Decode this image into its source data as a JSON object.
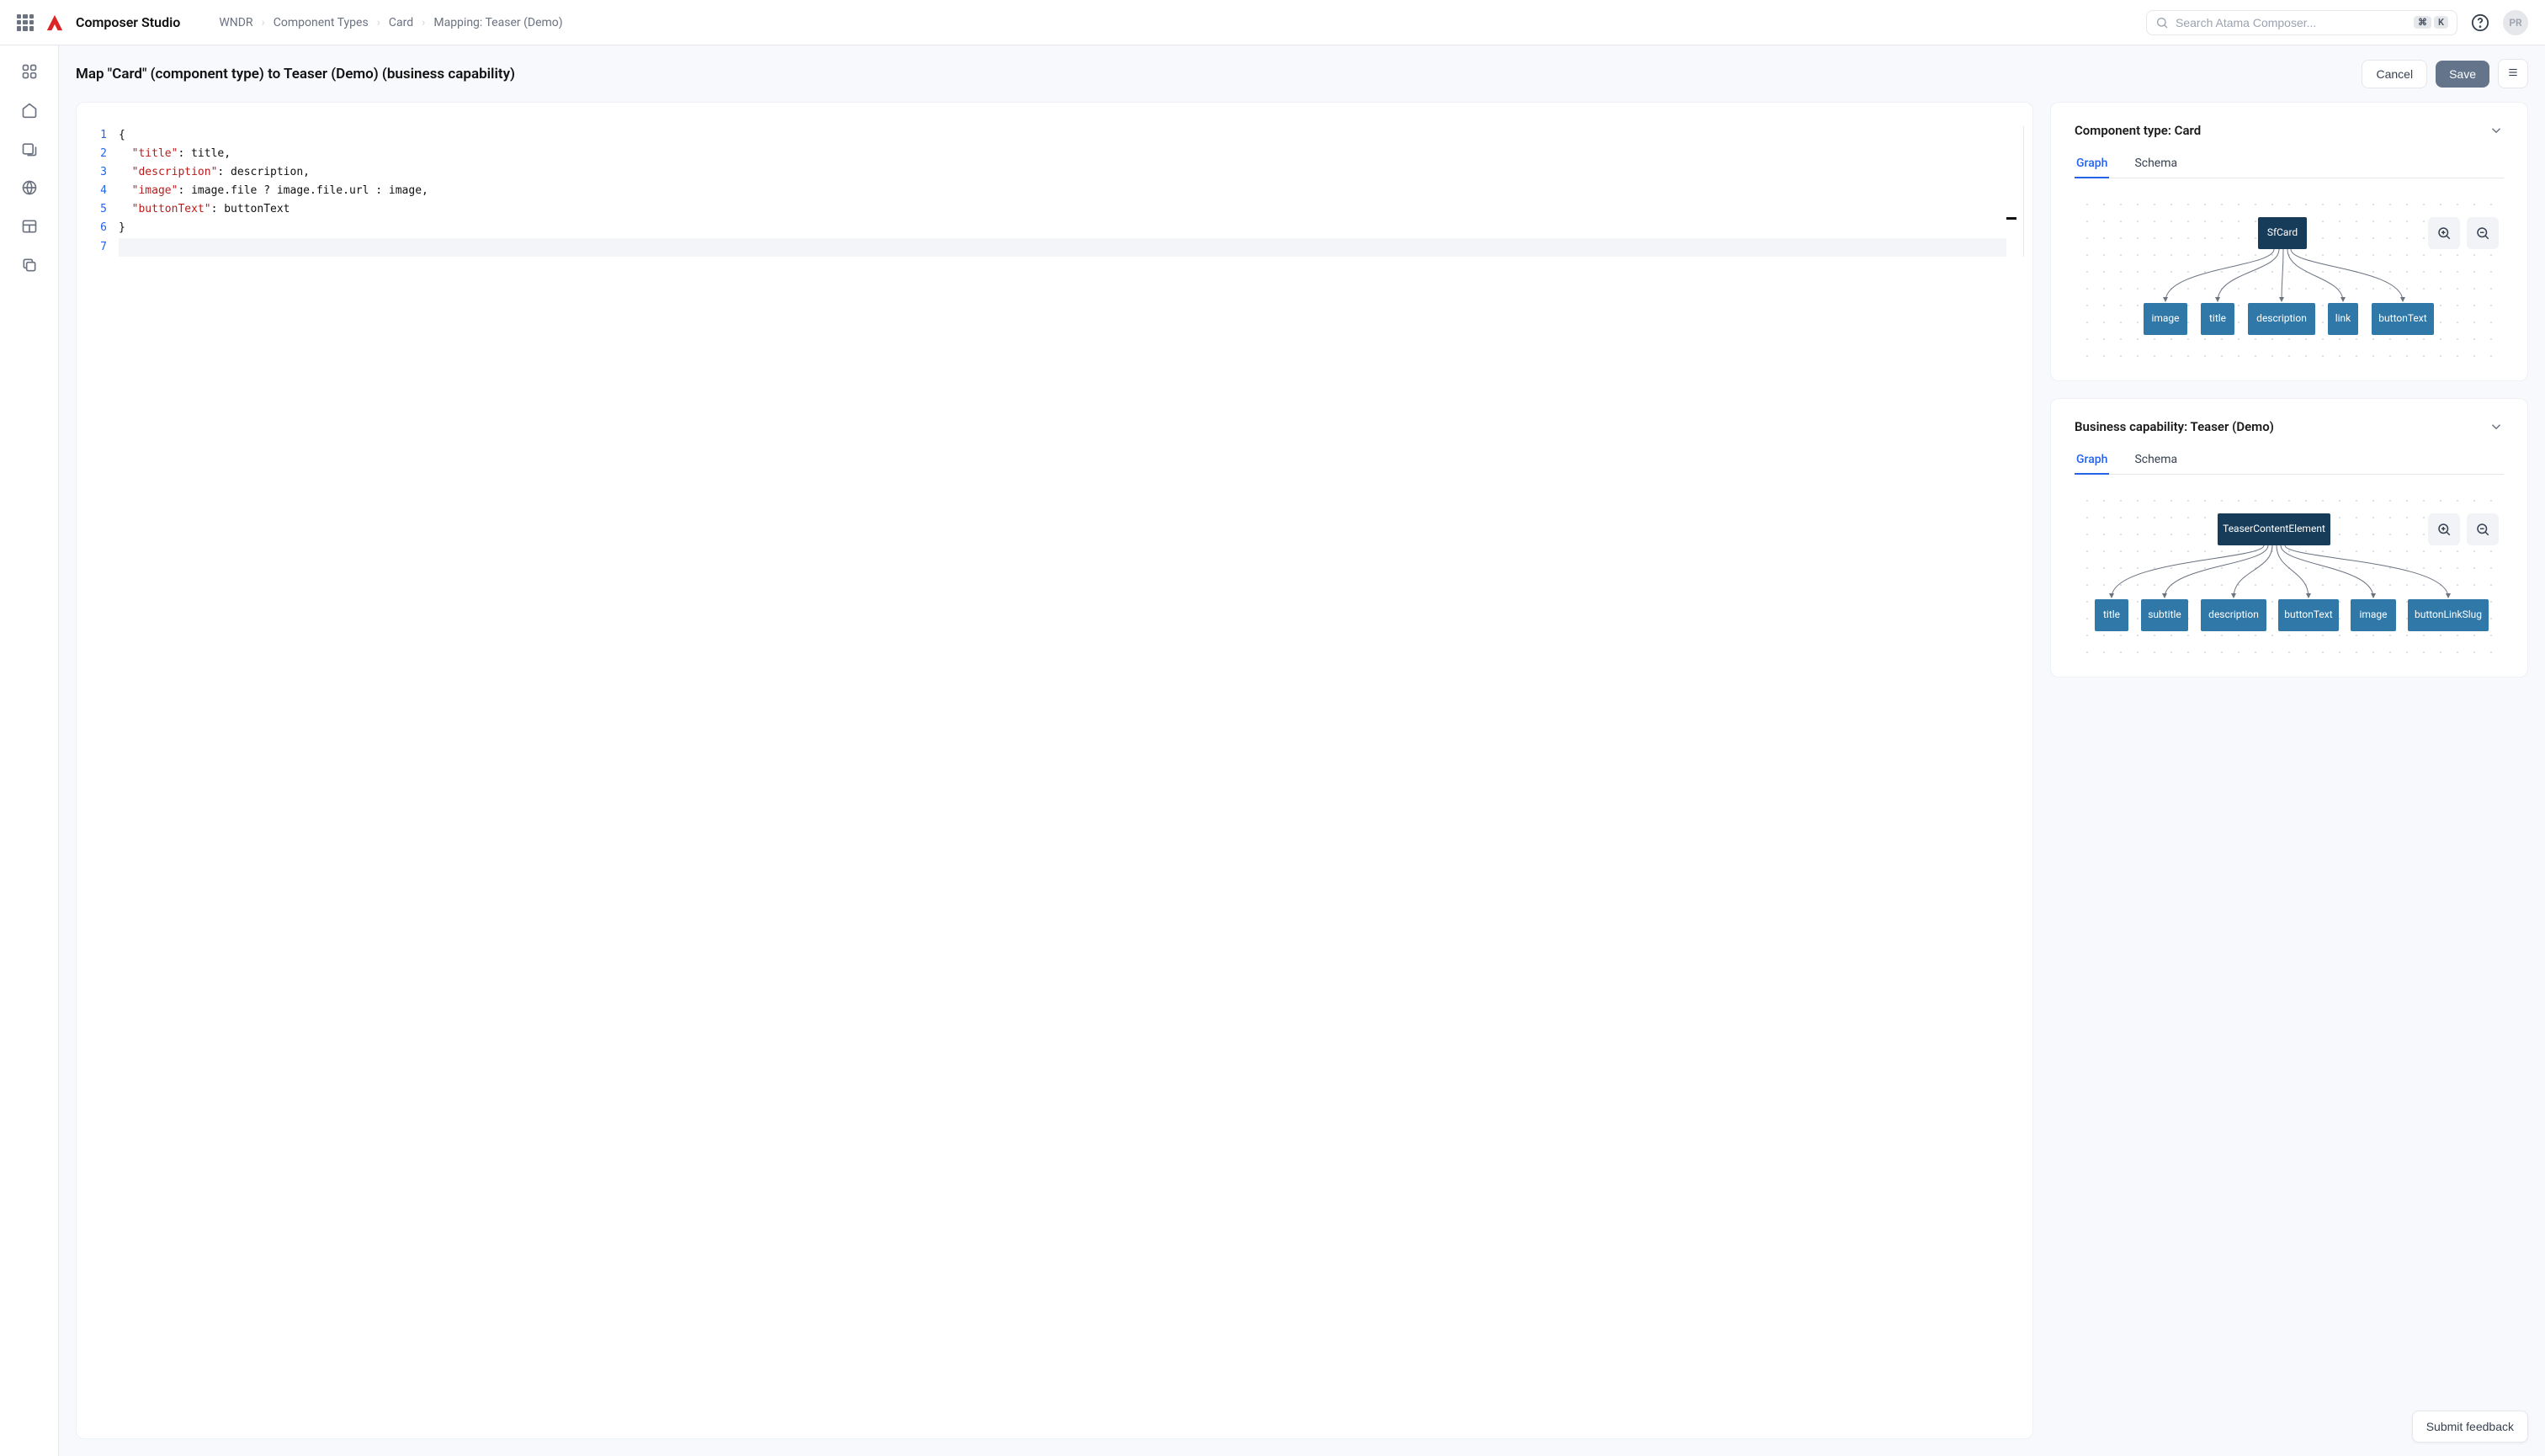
{
  "header": {
    "app_title": "Composer Studio",
    "breadcrumbs": [
      "WNDR",
      "Component Types",
      "Card",
      "Mapping: Teaser (Demo)"
    ],
    "search_placeholder": "Search Atama Composer...",
    "kbd1": "⌘",
    "kbd2": "K",
    "avatar": "PR"
  },
  "page": {
    "title": "Map \"Card\" (component type)  to Teaser (Demo) (business capability)",
    "cancel": "Cancel",
    "save": "Save"
  },
  "editor": {
    "lines": [
      "1",
      "2",
      "3",
      "4",
      "5",
      "6",
      "7"
    ],
    "code": {
      "l1": "{",
      "l2_key": "\"title\"",
      "l2_rest": ": title,",
      "l3_key": "\"description\"",
      "l3_rest": ": description,",
      "l4_key": "\"image\"",
      "l4_rest": ": image.file ? image.file.url : image,",
      "l5_key": "\"buttonText\"",
      "l5_rest": ": buttonText",
      "l6": "}",
      "l7": ""
    }
  },
  "panel1": {
    "title": "Component type: Card",
    "tab_graph": "Graph",
    "tab_schema": "Schema",
    "root": "SfCard",
    "children": [
      "image",
      "title",
      "description",
      "link",
      "buttonText"
    ]
  },
  "panel2": {
    "title": "Business capability: Teaser (Demo)",
    "tab_graph": "Graph",
    "tab_schema": "Schema",
    "root": "TeaserContentElement",
    "children": [
      "title",
      "subtitle",
      "description",
      "buttonText",
      "image",
      "buttonLinkSlug"
    ]
  },
  "feedback": "Submit feedback"
}
